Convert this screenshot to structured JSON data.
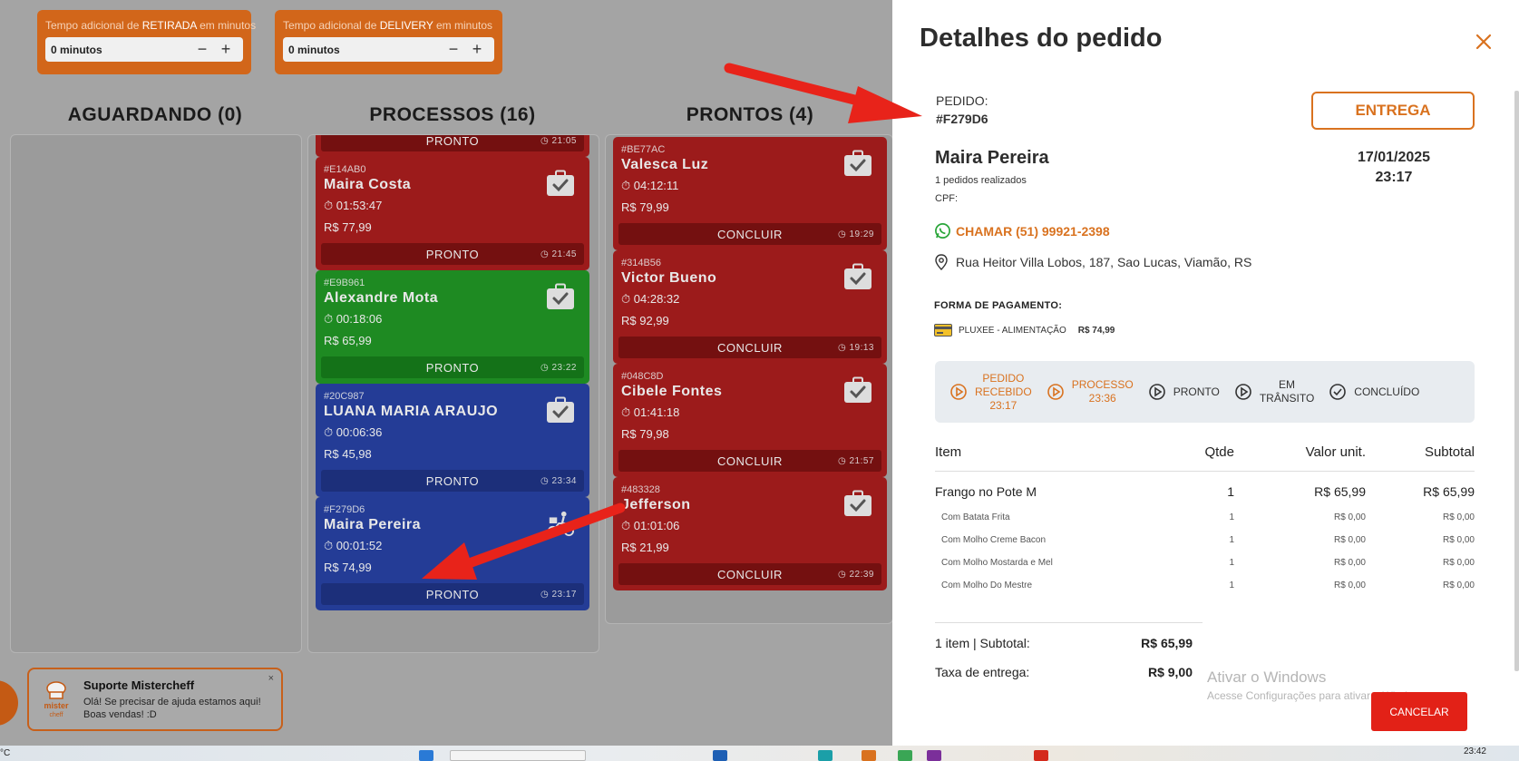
{
  "board": {
    "pickup": {
      "label_pre": "Tempo adicional de ",
      "label_em": "RETIRADA",
      "label_post": " em minutos",
      "value": "0 minutos",
      "minus": "−",
      "plus": "+"
    },
    "delivery": {
      "label_pre": "Tempo adicional de ",
      "label_em": "DELIVERY",
      "label_post": " em minutos",
      "value": "0 minutos",
      "minus": "−",
      "plus": "+"
    },
    "columns": {
      "aguardando": "AGUARDANDO (0)",
      "processos": "PROCESSOS (16)",
      "prontos": "PRONTOS (4)"
    },
    "processos_cards": [
      {
        "id": "",
        "name": "",
        "timer": "",
        "price": "",
        "action": "PRONTO",
        "clock": "21:05",
        "color": "red"
      },
      {
        "id": "#E14AB0",
        "name": "Maira Costa",
        "timer": "01:53:47",
        "price": "R$ 77,99",
        "action": "PRONTO",
        "clock": "21:45",
        "color": "red",
        "icon": "check-bag-icon"
      },
      {
        "id": "#E9B961",
        "name": "Alexandre Mota",
        "timer": "00:18:06",
        "price": "R$ 65,99",
        "action": "PRONTO",
        "clock": "23:22",
        "color": "green",
        "icon": "check-bag-icon"
      },
      {
        "id": "#20C987",
        "name": "LUANA MARIA ARAUJO",
        "timer": "00:06:36",
        "price": "R$ 45,98",
        "action": "PRONTO",
        "clock": "23:34",
        "color": "blue",
        "icon": "check-bag-icon"
      },
      {
        "id": "#F279D6",
        "name": "Maira Pereira",
        "timer": "00:01:52",
        "price": "R$ 74,99",
        "action": "PRONTO",
        "clock": "23:17",
        "color": "blue",
        "icon": "delivery-moto-icon"
      }
    ],
    "prontos_cards": [
      {
        "id": "#BE77AC",
        "name": "Valesca Luz",
        "timer": "04:12:11",
        "price": "R$ 79,99",
        "action": "CONCLUIR",
        "clock": "19:29",
        "color": "red"
      },
      {
        "id": "#314B56",
        "name": "Victor Bueno",
        "timer": "04:28:32",
        "price": "R$ 92,99",
        "action": "CONCLUIR",
        "clock": "19:13",
        "color": "red"
      },
      {
        "id": "#048C8D",
        "name": "Cibele Fontes",
        "timer": "01:41:18",
        "price": "R$ 79,98",
        "action": "CONCLUIR",
        "clock": "21:57",
        "color": "red"
      },
      {
        "id": "#483328",
        "name": "Jefferson",
        "timer": "01:01:06",
        "price": "R$ 21,99",
        "action": "CONCLUIR",
        "clock": "22:39",
        "color": "red"
      }
    ],
    "support": {
      "title": "Suporte Mistercheff",
      "message": "Olá! Se precisar de ajuda estamos aqui! Boas vendas! :D",
      "close": "×",
      "logo_text": "mister cheff"
    }
  },
  "modal": {
    "title": "Detalhes do pedido",
    "order_label": "PEDIDO:",
    "order_id": "#F279D6",
    "type_button": "ENTREGA",
    "customer_name": "Maira Pereira",
    "orders_count": "1 pedidos realizados",
    "cpf_label": "CPF:",
    "date": "17/01/2025",
    "time": "23:17",
    "whatsapp": "CHAMAR (51) 99921-2398",
    "address": "Rua Heitor Villa Lobos, 187, Sao Lucas, Viamão, RS",
    "payment_label": "FORMA DE PAGAMENTO:",
    "payment_method": "PLUXEE - ALIMENTAÇÃO",
    "payment_amount": "R$ 74,99",
    "steps": [
      {
        "line1": "PEDIDO",
        "line2": "RECEBIDO",
        "line3": "23:17",
        "state": "done"
      },
      {
        "line1": "PROCESSO",
        "line2": "23:36",
        "line3": "",
        "state": "done"
      },
      {
        "line1": "PRONTO",
        "line2": "",
        "line3": "",
        "state": "pending"
      },
      {
        "line1": "EM",
        "line2": "TRÂNSITO",
        "line3": "",
        "state": "pending"
      },
      {
        "line1": "CONCLUÍDO",
        "line2": "",
        "line3": "",
        "state": "check"
      }
    ],
    "table_headers": {
      "item": "Item",
      "qty": "Qtde",
      "unit": "Valor unit.",
      "subtotal": "Subtotal"
    },
    "main_item": {
      "name": "Frango no Pote M",
      "qty": "1",
      "unit": "R$ 65,99",
      "subtotal": "R$ 65,99"
    },
    "sub_items": [
      {
        "name": "Com Batata Frita",
        "qty": "1",
        "unit": "R$ 0,00",
        "subtotal": "R$ 0,00"
      },
      {
        "name": "Com Molho Creme Bacon",
        "qty": "1",
        "unit": "R$ 0,00",
        "subtotal": "R$ 0,00"
      },
      {
        "name": "Com Molho Mostarda e Mel",
        "qty": "1",
        "unit": "R$ 0,00",
        "subtotal": "R$ 0,00"
      },
      {
        "name": "Com Molho Do Mestre",
        "qty": "1",
        "unit": "R$ 0,00",
        "subtotal": "R$ 0,00"
      }
    ],
    "summary_subtotal_label": "1 item | Subtotal:",
    "summary_subtotal": "R$ 65,99",
    "summary_fee_label": "Taxa de entrega:",
    "summary_fee": "R$ 9,00",
    "cancel_button": "CANCELAR",
    "watermark_title": "Ativar o Windows",
    "watermark_sub": "Acesse Configurações para ativar o Windows."
  },
  "taskbar": {
    "temp": "°C",
    "clock": "23:42"
  },
  "colors": {
    "accent": "#d9721f",
    "red_card": "#9c1b1b",
    "green_card": "#1e8a22",
    "blue_card": "#243c96",
    "cancel": "#e22117",
    "arrow": "#e8231a"
  }
}
